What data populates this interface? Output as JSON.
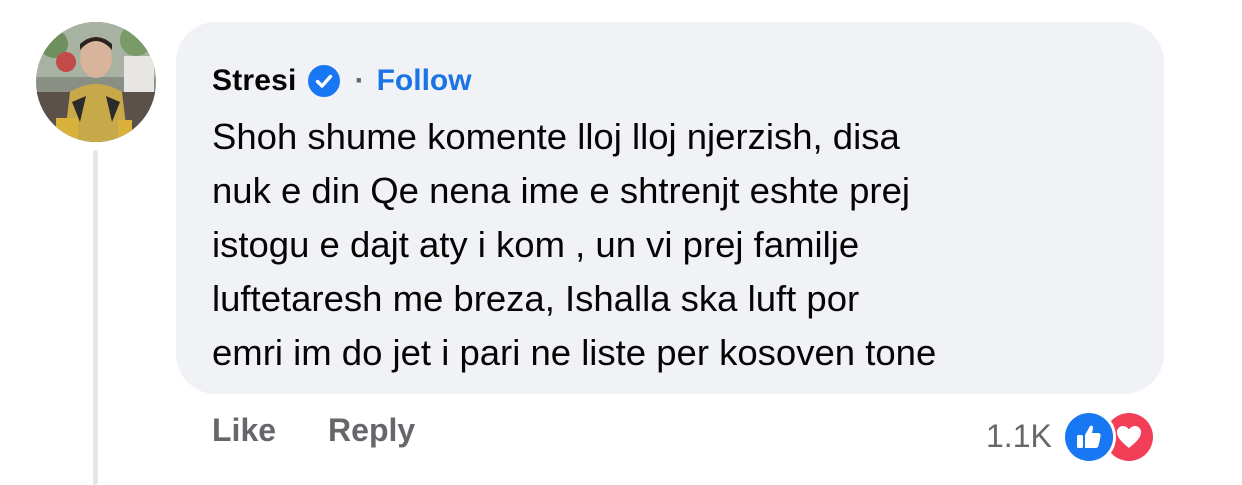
{
  "comment": {
    "author": "Stresi",
    "separator": "·",
    "follow_label": "Follow",
    "text": "Shoh shume komente lloj lloj njerzish, disa\nnuk e din Qe nena ime e shtrenjt eshte prej\nistogu e dajt aty i kom  , un vi prej familje\nluftetaresh me breza, Ishalla ska luft por\nemri im do jet i pari ne liste per kosoven tone"
  },
  "actions": {
    "like_label": "Like",
    "reply_label": "Reply"
  },
  "reactions": {
    "count": "1.1K",
    "icons": [
      "like-reaction-icon",
      "love-reaction-icon"
    ]
  },
  "colors": {
    "bubble": "#f0f2f5",
    "link": "#1b74e4",
    "secondary_text": "#65676b",
    "like": "#1877f2",
    "love": "#f33e58"
  }
}
